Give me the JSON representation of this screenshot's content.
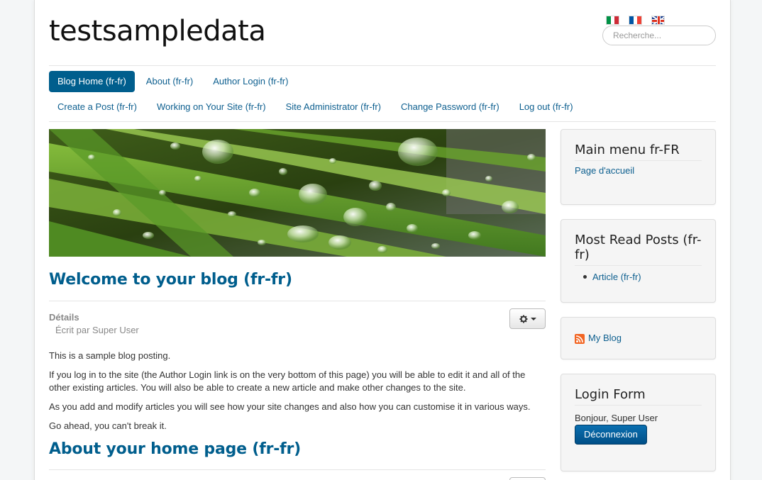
{
  "site": {
    "title": "testsampledata"
  },
  "languages": [
    {
      "name": "Italiano",
      "icon": "italy-flag-icon"
    },
    {
      "name": "Français",
      "icon": "france-flag-icon"
    },
    {
      "name": "English",
      "icon": "uk-flag-icon"
    }
  ],
  "search": {
    "placeholder": "Recherche..."
  },
  "nav": {
    "primary": [
      {
        "label": "Blog Home (fr-fr)",
        "active": true
      },
      {
        "label": "About (fr-fr)"
      },
      {
        "label": "Author Login (fr-fr)"
      }
    ],
    "secondary": [
      {
        "label": "Create a Post (fr-fr)"
      },
      {
        "label": "Working on Your Site (fr-fr)"
      },
      {
        "label": "Site Administrator (fr-fr)"
      },
      {
        "label": "Change Password (fr-fr)"
      },
      {
        "label": "Log out (fr-fr)"
      }
    ]
  },
  "main": {
    "article1": {
      "title": "Welcome to your blog (fr-fr)",
      "details_label": "Détails",
      "author": "Écrit par Super User",
      "paragraphs": [
        "This is a sample blog posting.",
        "If you log in to the site (the Author Login link is on the very bottom of this page) you will be able to edit it and all of the other existing articles. You will also be able to create a new article and make other changes to the site.",
        "As you add and modify articles you will see how your site changes and also how you can customise it in various ways.",
        "Go ahead, you can't break it."
      ]
    },
    "article2": {
      "title": "About your home page (fr-fr)"
    }
  },
  "sidebar": {
    "main_menu": {
      "title": "Main menu fr-FR",
      "link": "Page d'accueil"
    },
    "most_read": {
      "title": "Most Read Posts (fr-fr)",
      "item": "Article (fr-fr)"
    },
    "feed": {
      "label": "My Blog",
      "icon": "rss-icon"
    },
    "login": {
      "title": "Login Form",
      "greeting": "Bonjour, Super User",
      "button": "Déconnexion"
    }
  },
  "colors": {
    "accent": "#005e8d",
    "link": "#0d5f8f",
    "rss": "#f26522"
  }
}
